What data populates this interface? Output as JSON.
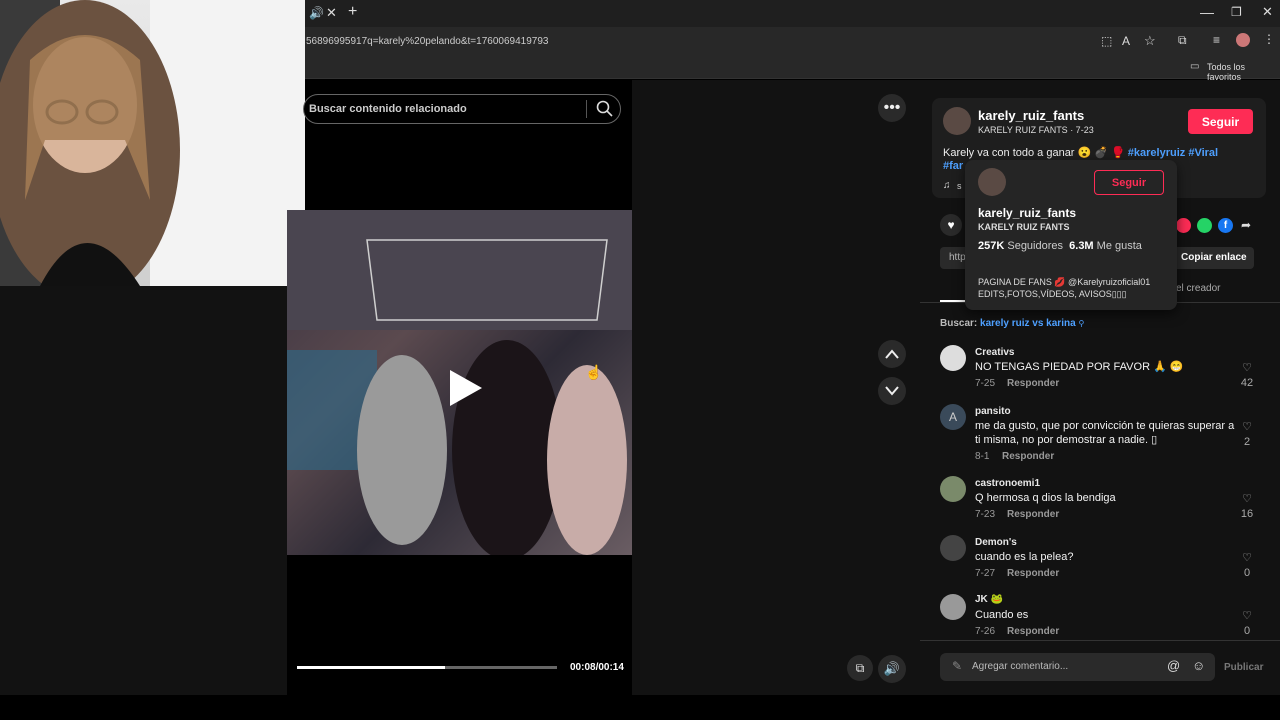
{
  "browser": {
    "url": "56896995917q=karely%20pelando&t=1760069419793",
    "bookmarks_label": "Todos los favoritos"
  },
  "player": {
    "search_placeholder": "Buscar contenido relacionado",
    "time": "00:08/00:14",
    "progress": 0.57
  },
  "author": {
    "username": "karely_ruiz_fants",
    "meta": "KARELY RUIZ FANTS · 7-23",
    "follow_label": "Seguir",
    "caption": "Karely va con todo a ganar 😮 💣 🥊 ",
    "hashtags": "#karelyruiz #Viral",
    "hashtag2": "#far",
    "music_prefix": "s"
  },
  "hover_card": {
    "username": "karely_ruiz_fants",
    "display_name": "KARELY RUIZ FANTS",
    "followers_count": "257K",
    "followers_label": "Seguidores",
    "likes_count": "6.3M",
    "likes_label": "Me gusta",
    "bio_line1": "PAGINA DE FANS 💋 @Karelyruizoficial01",
    "bio_line2": "EDITS,FOTOS,VÍDEOS, AVISOS▯▯▯",
    "follow_label": "Seguir"
  },
  "share": {
    "link_prefix": "http",
    "copy_label": "Copiar enlace",
    "tab_creator": "el creador"
  },
  "search_suggest": {
    "prefix": "Buscar:",
    "query": "karely ruiz vs karina"
  },
  "comments": [
    {
      "user": "Creativs",
      "text": "NO TENGAS PIEDAD POR FAVOR 🙏 😁",
      "date": "7-25",
      "reply": "Responder",
      "likes": "42",
      "avatar_letter": ""
    },
    {
      "user": "pansito",
      "text": "me da gusto, que por convicción te quieras superar a ti misma, no por demostrar a nadie. ▯",
      "date": "8-1",
      "reply": "Responder",
      "likes": "2",
      "avatar_letter": "A"
    },
    {
      "user": "castronoemi1",
      "text": "Q hermosa q dios la bendiga",
      "date": "7-23",
      "reply": "Responder",
      "likes": "16",
      "avatar_letter": ""
    },
    {
      "user": "Demon's",
      "text": "cuando es la pelea?",
      "date": "7-27",
      "reply": "Responder",
      "likes": "0",
      "avatar_letter": ""
    },
    {
      "user": "JK 🐸",
      "text": "Cuando es",
      "date": "7-26",
      "reply": "Responder",
      "likes": "0",
      "avatar_letter": ""
    }
  ],
  "comment_input": {
    "placeholder": "Agregar comentario...",
    "publish_label": "Publicar"
  },
  "icons": {
    "accent": "#fe2c55",
    "link": "#4ea0ff"
  }
}
